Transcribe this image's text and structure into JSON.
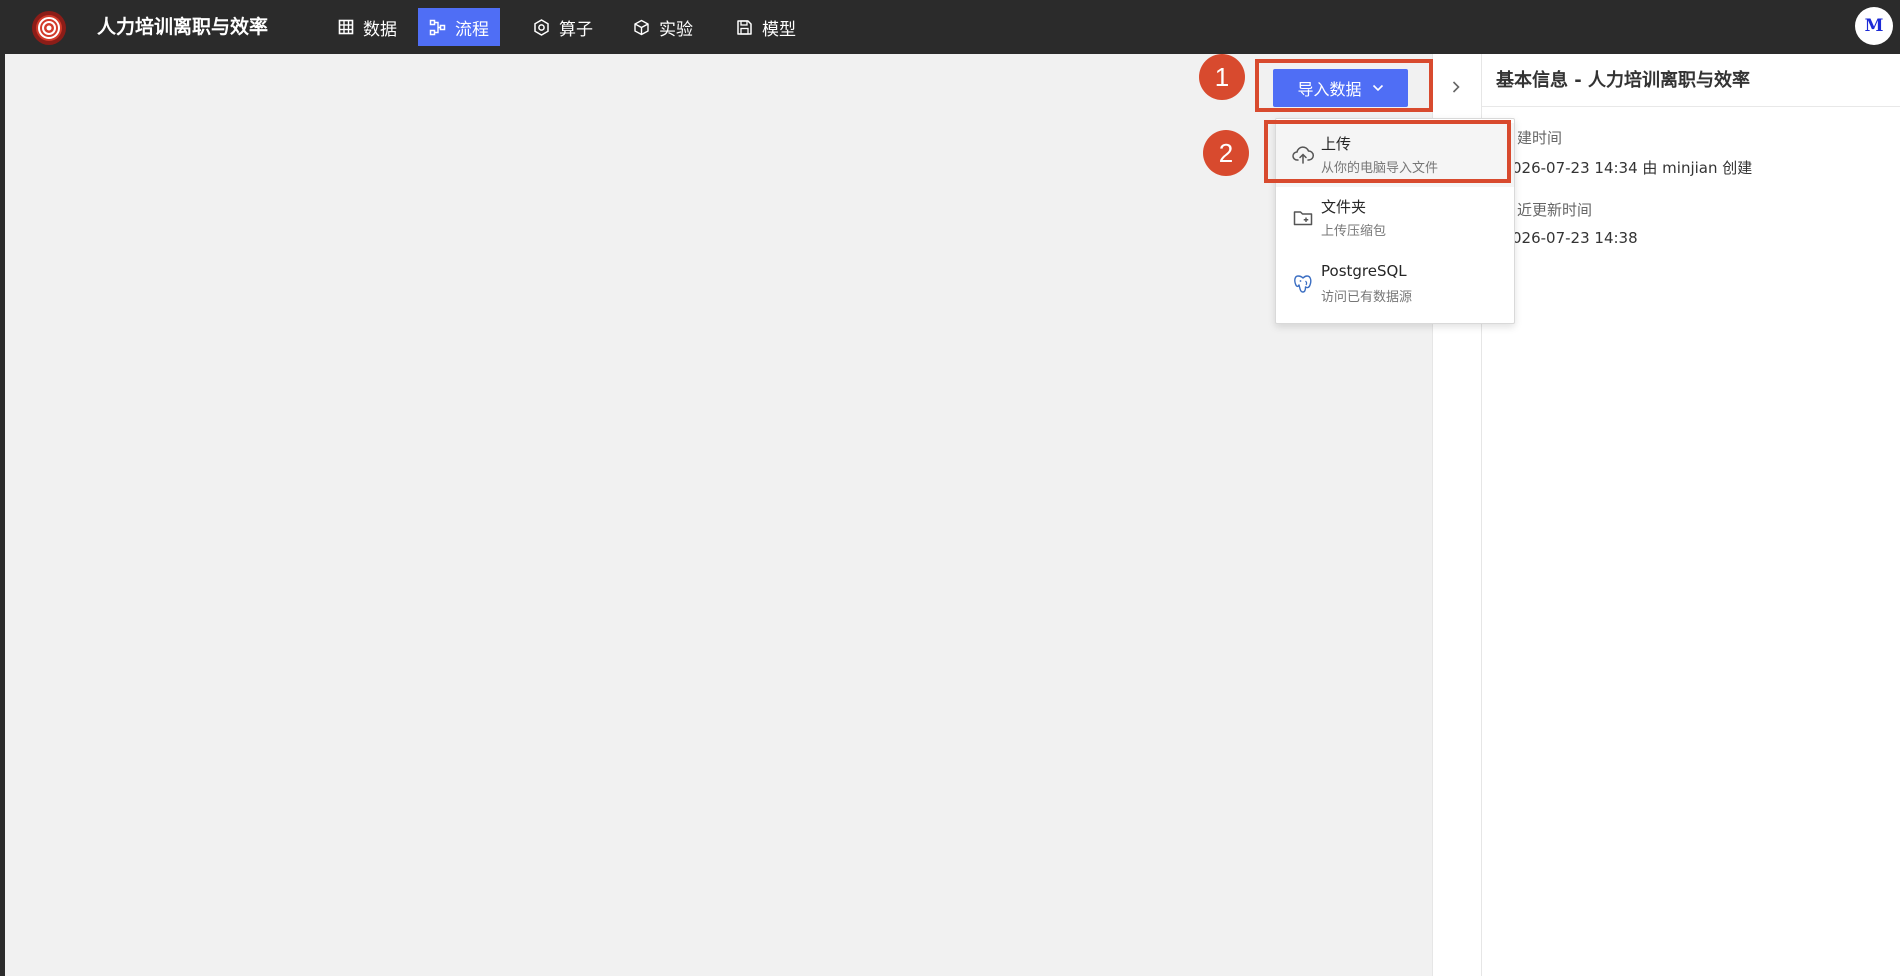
{
  "app": {
    "title": "人力培训离职与效率"
  },
  "nav": {
    "items": [
      {
        "label": "数据",
        "icon": "table-icon",
        "active": false
      },
      {
        "label": "流程",
        "icon": "flow-icon",
        "active": true
      },
      {
        "label": "算子",
        "icon": "operator-icon",
        "active": false
      },
      {
        "label": "实验",
        "icon": "cube-icon",
        "active": false
      },
      {
        "label": "模型",
        "icon": "save-icon",
        "active": false
      }
    ]
  },
  "user": {
    "avatar_initial": "M"
  },
  "toolbar": {
    "import_label": "导入数据"
  },
  "dropdown": {
    "items": [
      {
        "label": "上传",
        "desc": "从你的电脑导入文件",
        "icon": "upload-cloud-icon"
      },
      {
        "label": "文件夹",
        "desc": "上传压缩包",
        "icon": "folder-add-icon"
      },
      {
        "label": "PostgreSQL",
        "desc": "访问已有数据源",
        "icon": "postgresql-icon"
      }
    ]
  },
  "info": {
    "title": "基本信息 - 人力培训离职与效率",
    "created_label": "建时间",
    "created_value": "026-07-23 14:34  由 minjian 创建",
    "updated_label": "近更新时间",
    "updated_value": "026-07-23 14:38"
  },
  "annotations": {
    "step1": "1",
    "step2": "2"
  },
  "colors": {
    "accent": "#4f6ef5",
    "highlight": "#d84a2e",
    "topbar": "#2b2b2b",
    "canvas": "#f1f1f1"
  }
}
